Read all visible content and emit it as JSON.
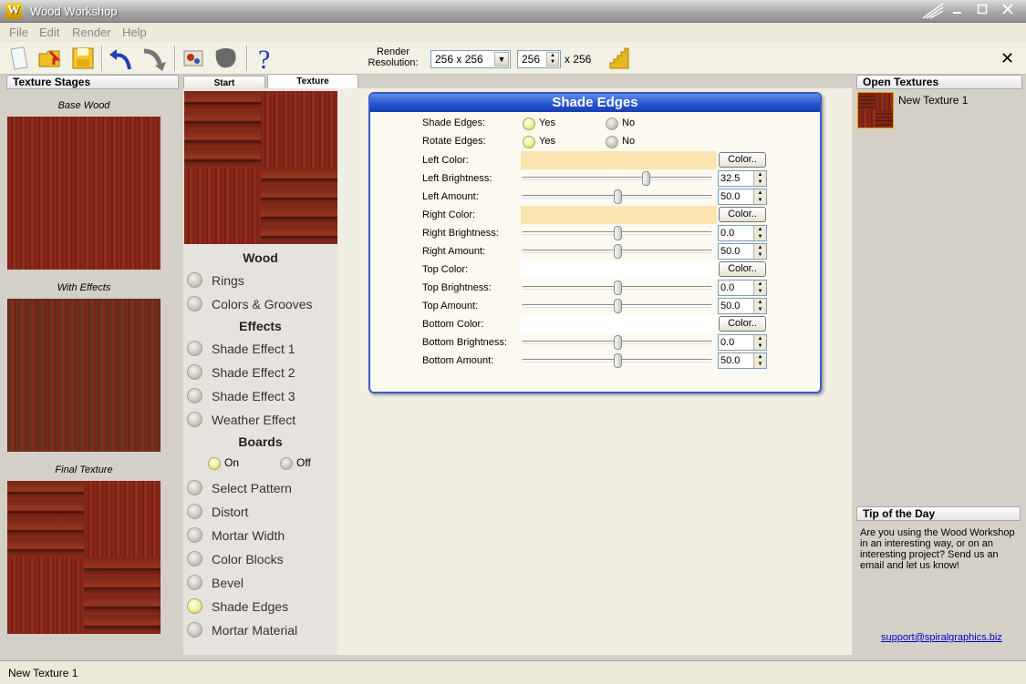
{
  "window": {
    "title": "Wood Workshop",
    "logo_letter": "W"
  },
  "menu": [
    "File",
    "Edit",
    "Render",
    "Help"
  ],
  "toolbar": {
    "render_label": "Render Resolution:",
    "resolution": "256 x 256",
    "width": "256",
    "height_text": "x 256",
    "close": "✕"
  },
  "left_panel": {
    "header": "Texture Stages",
    "stages": [
      "Base Wood",
      "With Effects",
      "Final Texture"
    ]
  },
  "tabs": [
    "Start",
    "Texture"
  ],
  "list": {
    "wood_title": "Wood",
    "wood_items": [
      "Rings",
      "Colors & Grooves"
    ],
    "effects_title": "Effects",
    "effects_items": [
      "Shade Effect 1",
      "Shade Effect 2",
      "Shade Effect 3",
      "Weather Effect"
    ],
    "boards_title": "Boards",
    "boards_on": "On",
    "boards_off": "Off",
    "boards_items": [
      "Select Pattern",
      "Distort",
      "Mortar Width",
      "Color Blocks",
      "Bevel",
      "Shade Edges",
      "Mortar Material"
    ],
    "selected": "Shade Edges"
  },
  "dialog": {
    "title": "Shade Edges",
    "shade_edges_label": "Shade Edges:",
    "rotate_edges_label": "Rotate Edges:",
    "yes": "Yes",
    "no": "No",
    "color_btn": "Color..",
    "rows": [
      {
        "label": "Left Color:",
        "type": "color",
        "color": "#fbe4b0"
      },
      {
        "label": "Left Brightness:",
        "type": "slider",
        "value": "32.5",
        "level": 0.65
      },
      {
        "label": "Left Amount:",
        "type": "slider",
        "value": "50.0",
        "level": 0.5
      },
      {
        "label": "Right Color:",
        "type": "color",
        "color": "#fbe4b0"
      },
      {
        "label": "Right Brightness:",
        "type": "slider",
        "value": "0.0",
        "level": 0.5
      },
      {
        "label": "Right Amount:",
        "type": "slider",
        "value": "50.0",
        "level": 0.5
      },
      {
        "label": "Top Color:",
        "type": "color",
        "color": "#ffffff"
      },
      {
        "label": "Top Brightness:",
        "type": "slider",
        "value": "0.0",
        "level": 0.5
      },
      {
        "label": "Top Amount:",
        "type": "slider",
        "value": "50.0",
        "level": 0.5
      },
      {
        "label": "Bottom Color:",
        "type": "color",
        "color": "#ffffff"
      },
      {
        "label": "Bottom Brightness:",
        "type": "slider",
        "value": "0.0",
        "level": 0.5
      },
      {
        "label": "Bottom Amount:",
        "type": "slider",
        "value": "50.0",
        "level": 0.5
      }
    ]
  },
  "right_panel": {
    "open_header": "Open Textures",
    "texture_name": "New Texture 1",
    "tip_header": "Tip of the Day",
    "tip_text": "Are you using the Wood Workshop in an interesting way, or on an interesting project? Send us an email and let us know!",
    "support": "support@spiralgraphics.biz"
  },
  "status": {
    "text": "New Texture 1"
  }
}
